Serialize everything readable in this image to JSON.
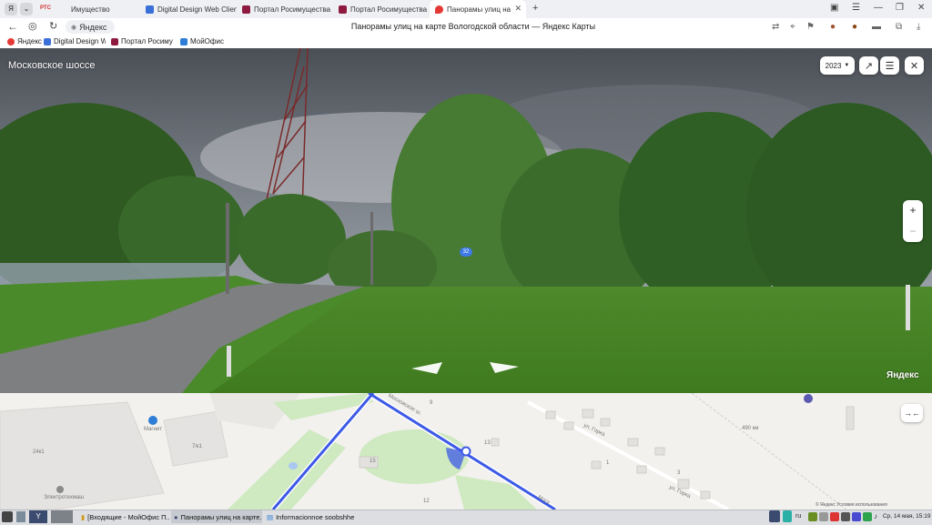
{
  "browser": {
    "tabs": [
      {
        "label": "Имущество"
      },
      {
        "label": "Digital Design Web Client"
      },
      {
        "label": "Портал Росимущества"
      },
      {
        "label": "Портал Росимущества"
      },
      {
        "label": "Панорамы улиц на карте"
      }
    ],
    "omnibox": {
      "text": "Яндекс"
    },
    "page_title": "Панорамы улиц на карте Вологодской области — Яндекс Карты",
    "bookmarks": [
      {
        "label": "Яндекс"
      },
      {
        "label": "Digital Design We"
      },
      {
        "label": "Портал Росимущ"
      },
      {
        "label": "МойОфис"
      }
    ]
  },
  "panorama": {
    "street_name": "Московское шоссе",
    "year": "2023",
    "watermark": "Яндекс",
    "road_number": "32",
    "zoom_in": "+",
    "zoom_out": "−"
  },
  "map": {
    "labels": {
      "magnit": "Магнит",
      "b24k1": "24к1",
      "b7k1": "7/к1",
      "electro": "Электротехмаш",
      "moskovskoe": "Московское ш.",
      "moskovskoe2": "Моск",
      "gorka1": "ул. Горка",
      "gorka2": "ул. Горка",
      "km490": "490 км",
      "h13": "13",
      "h9": "9",
      "h12": "12",
      "h15": "15",
      "h1": "1",
      "h3": "3",
      "copyright": "© Яндекс   Условия использования"
    }
  },
  "taskbar": {
    "items": [
      {
        "label": "[Входящие - МойОфис П..."
      },
      {
        "label": "Панорамы улиц на карте..."
      },
      {
        "label": "Informacionnoe soobshhe..."
      }
    ],
    "lang": "ru",
    "clock": "Ср, 14 мая, 15:19"
  },
  "colors": {
    "accent": "#3d5ae6",
    "active_tab_pin": "#e53935",
    "park_green": "#cfe9c0"
  }
}
